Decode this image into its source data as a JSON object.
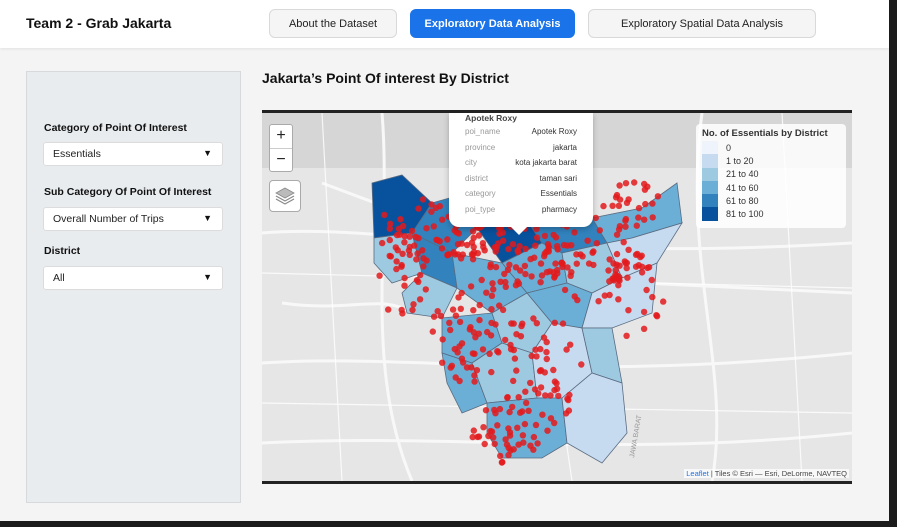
{
  "header": {
    "brand": "Team 2 - Grab Jakarta",
    "tabs": [
      {
        "label": "About the Dataset"
      },
      {
        "label": "Exploratory Data Analysis"
      },
      {
        "label": "Exploratory Spatial Data Analysis"
      }
    ]
  },
  "sidebar": {
    "category_label": "Category of Point Of Interest",
    "category_value": "Essentials",
    "subcategory_label": "Sub Category Of Point Of Interest",
    "subcategory_value": "Overall Number of Trips",
    "district_label": "District",
    "district_value": "All",
    "caret": "▼"
  },
  "main": {
    "title": "Jakarta’s Point Of interest By District"
  },
  "map": {
    "zoom_in": "+",
    "zoom_out": "−",
    "legend": {
      "title": "No. of Essentials by District",
      "items": [
        {
          "label": "0",
          "color": "#eff3fb"
        },
        {
          "label": "1 to 20",
          "color": "#c6dbef"
        },
        {
          "label": "21 to 40",
          "color": "#9ecae1"
        },
        {
          "label": "41 to 60",
          "color": "#6baed6"
        },
        {
          "label": "61 to 80",
          "color": "#3182bd"
        },
        {
          "label": "81 to 100",
          "color": "#08519c"
        }
      ]
    },
    "popup": {
      "title": "Apotek Roxy",
      "rows": [
        {
          "key": "poi_name",
          "value": "Apotek Roxy"
        },
        {
          "key": "province",
          "value": "jakarta"
        },
        {
          "key": "city",
          "value": "kota jakarta barat"
        },
        {
          "key": "district",
          "value": "taman sari"
        },
        {
          "key": "category",
          "value": "Essentials"
        },
        {
          "key": "poi_type",
          "value": "pharmacy"
        }
      ]
    },
    "attribution_link": "Leaflet",
    "attribution_text": " | Tiles © Esri — Esri, DeLorme, NAVTEQ",
    "street_label": "JAWA BARAT",
    "poi_color": "#e31a1c"
  }
}
